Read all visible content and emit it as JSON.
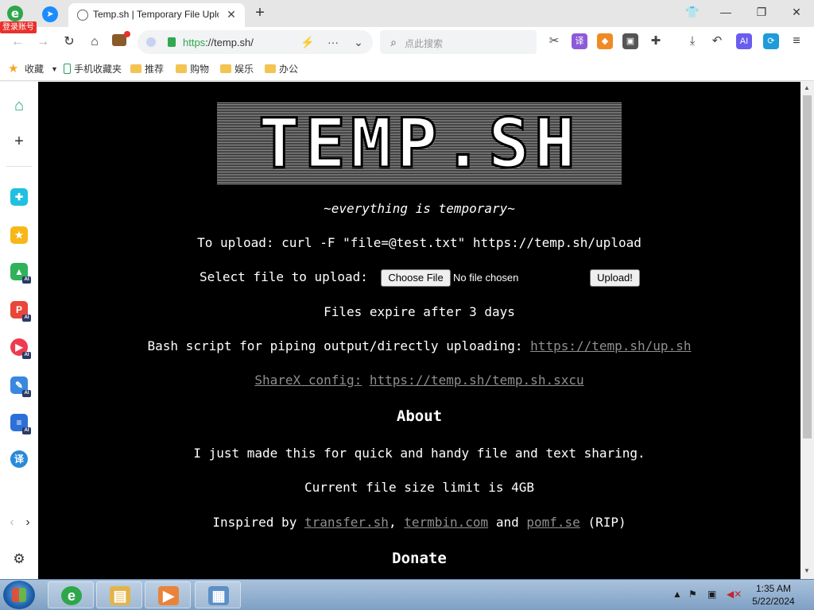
{
  "browser": {
    "login_badge": "登录账号",
    "tab_title": "Temp.sh | Temporary File Uplo",
    "tab_close": "✕",
    "new_tab": "+",
    "url_scheme": "https",
    "url_rest": "://temp.sh/",
    "search_placeholder": "点此搜索",
    "window_controls": {
      "minimize": "—",
      "restore": "❐",
      "close": "✕"
    }
  },
  "bookmarks": {
    "favorites_label": "收藏",
    "mobile_label": "手机收藏夹",
    "folders": [
      "推荐",
      "购物",
      "娱乐",
      "办公"
    ]
  },
  "page": {
    "logo_text": "TEMP.SH",
    "tagline": "~everything is temporary~",
    "upload_cmd": "To upload: curl -F \"file=@test.txt\" https://temp.sh/upload",
    "select_label": "Select file to upload:",
    "choose_file": "Choose File",
    "no_file": "No file chosen",
    "upload_button": "Upload!",
    "expiry": "Files expire after 3 days",
    "bash_label": "Bash script for piping output/directly uploading:",
    "bash_link": "https://temp.sh/up.sh",
    "sharex_label": "ShareX config:",
    "sharex_link": "https://temp.sh/temp.sh.sxcu",
    "about_heading": "About",
    "about_text": "I just made this for quick and handy file and text sharing.",
    "size_limit": "Current file size limit is 4GB",
    "inspired_prefix": "Inspired by",
    "inspired_links": [
      "transfer.sh",
      "termbin.com",
      "pomf.se"
    ],
    "inspired_sep": ",",
    "inspired_and": "and",
    "inspired_suffix": "(RIP)",
    "donate_heading": "Donate"
  },
  "taskbar": {
    "time": "1:35 AM",
    "date": "5/22/2024"
  },
  "colors": {
    "page_background": "#000000",
    "link_color": "#8f8f8f",
    "login_badge": "#e8312c"
  },
  "icons": {
    "sidebar": [
      "home-icon",
      "plus-icon",
      "plugin-icon",
      "star-icon",
      "image-ai-icon",
      "pdf-ai-icon",
      "video-ai-icon",
      "edit-ai-icon",
      "doc-ai-icon",
      "translate-icon"
    ],
    "toolbar": [
      "scissors-icon",
      "translate-icon",
      "game-icon",
      "screen-icon",
      "extension-icon",
      "download-icon",
      "undo-icon",
      "ai-icon",
      "sync-icon",
      "menu-icon"
    ]
  }
}
